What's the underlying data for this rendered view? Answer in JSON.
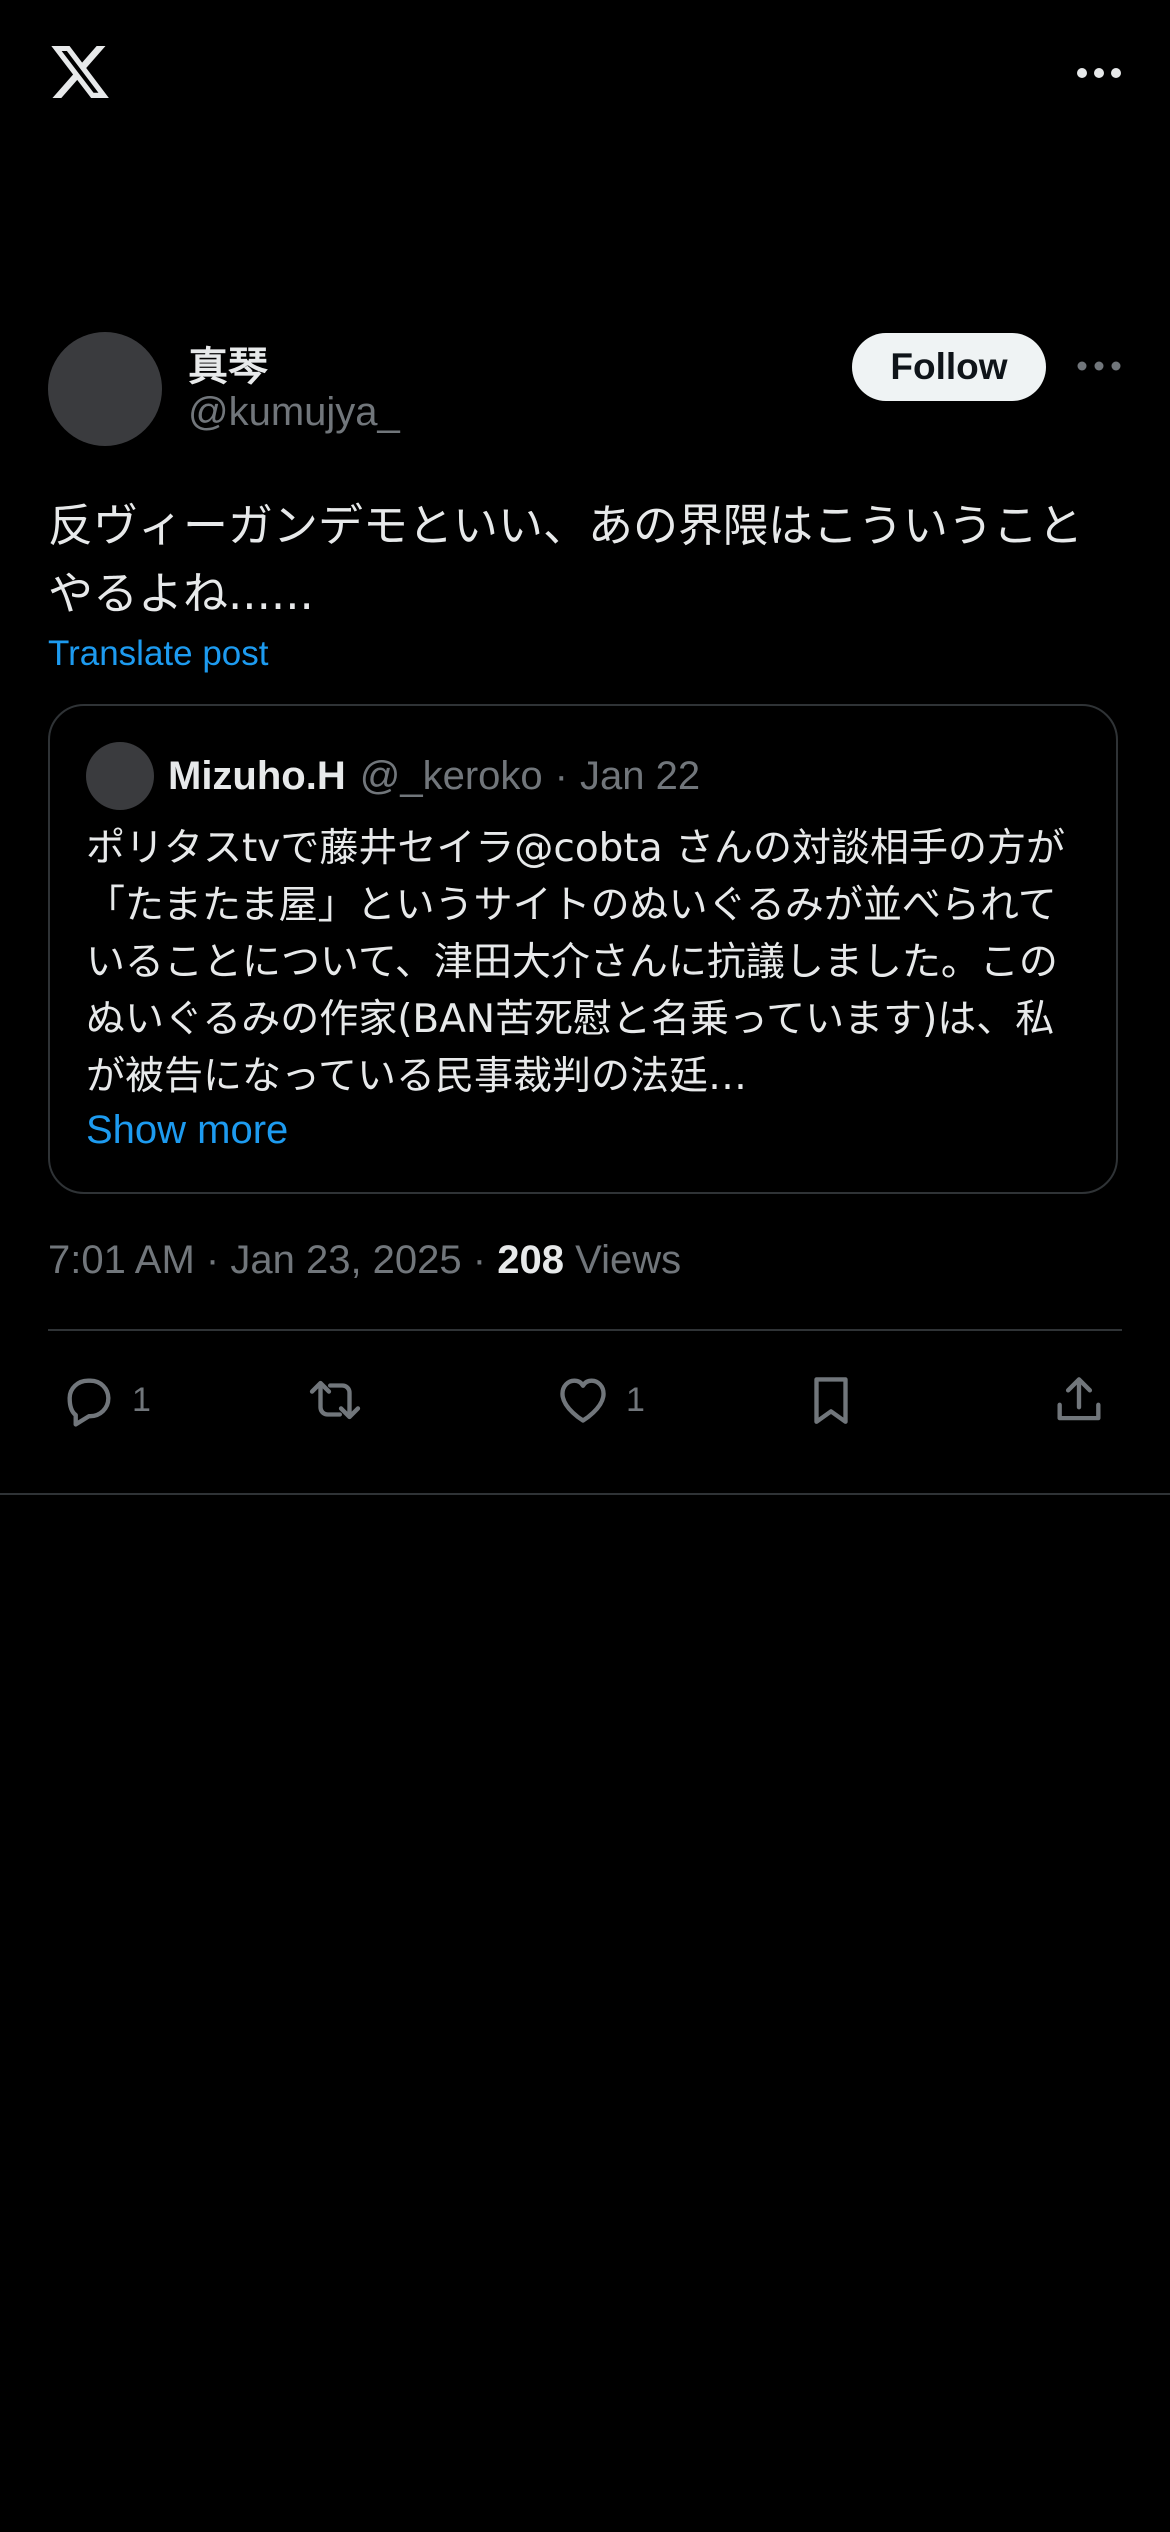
{
  "topbar": {
    "logo_icon": "x-logo-icon",
    "more_icon": "more-horizontal-icon"
  },
  "post": {
    "display_name": "真琴",
    "handle": "@kumujya_",
    "follow_label": "Follow",
    "text": "反ヴィーガンデモといい、あの界隈はこういうことやるよね......",
    "translate_label": "Translate post",
    "quote": {
      "name": "Mizuho.H",
      "handle": "@_keroko",
      "separator": "·",
      "date": "Jan 22",
      "text": "ポリタスtvで藤井セイラ@cobta さんの対談相手の方が「たまたま屋」というサイトのぬいぐるみが並べられていることについて、津田大介さんに抗議しました。このぬいぐるみの作家(BAN苦死慰と名乗っています)は、私が被告になっている民事裁判の法廷…",
      "show_more_label": "Show more"
    },
    "time": "7:01 AM",
    "dot": "·",
    "date": "Jan 23, 2025",
    "views_count": "208",
    "views_label": "Views",
    "actions": {
      "reply_count": "1",
      "like_count": "1"
    }
  },
  "colors": {
    "background": "#000000",
    "text_primary": "#e7e9ea",
    "text_secondary": "#71767b",
    "accent": "#1d9bf0",
    "border": "#2f3336"
  }
}
